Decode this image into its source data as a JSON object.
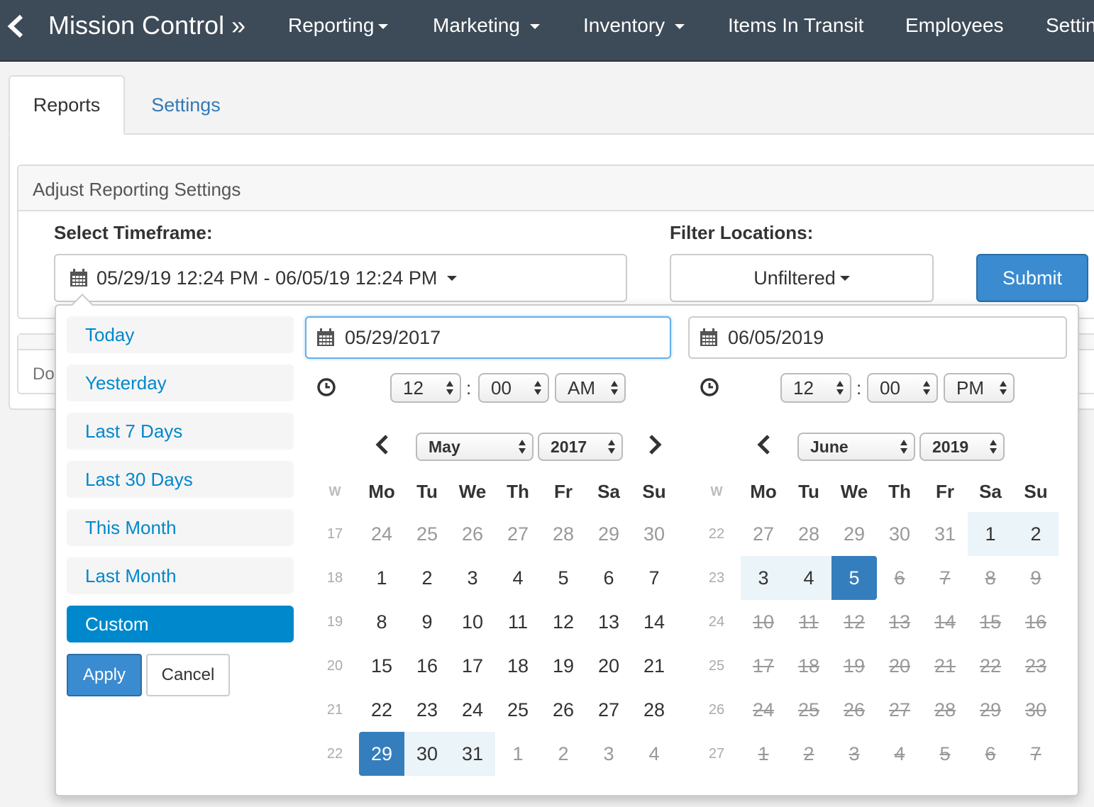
{
  "navbar": {
    "brand": "Mission Control »",
    "items": [
      "Reporting",
      "Marketing",
      "Inventory",
      "Items In Transit",
      "Employees",
      "Settings"
    ]
  },
  "tabs": {
    "active": "Reports",
    "other": "Settings"
  },
  "panel": {
    "title": "Adjust Reporting Settings",
    "timeframe_label": "Select Timeframe:",
    "timeframe_value": "05/29/19 12:24 PM - 06/05/19 12:24 PM",
    "filter_label": "Filter Locations:",
    "filter_value": "Unfiltered",
    "submit_label": "Submit",
    "second_panel_text": "Do"
  },
  "picker": {
    "ranges": [
      "Today",
      "Yesterday",
      "Last 7 Days",
      "Last 30 Days",
      "This Month",
      "Last Month",
      "Custom"
    ],
    "active_range": "Custom",
    "apply_label": "Apply",
    "cancel_label": "Cancel",
    "start": {
      "date": "05/29/2017",
      "hour": "12",
      "minute": "00",
      "ampm": "AM",
      "month": "May",
      "year": "2017",
      "weeks": [
        {
          "w": "17",
          "days": [
            [
              "24",
              "muted"
            ],
            [
              "25",
              "muted"
            ],
            [
              "26",
              "muted"
            ],
            [
              "27",
              "muted"
            ],
            [
              "28",
              "muted"
            ],
            [
              "29",
              "muted"
            ],
            [
              "30",
              "muted"
            ]
          ]
        },
        {
          "w": "18",
          "days": [
            [
              "1",
              ""
            ],
            [
              "2",
              ""
            ],
            [
              "3",
              ""
            ],
            [
              "4",
              ""
            ],
            [
              "5",
              ""
            ],
            [
              "6",
              ""
            ],
            [
              "7",
              ""
            ]
          ]
        },
        {
          "w": "19",
          "days": [
            [
              "8",
              ""
            ],
            [
              "9",
              ""
            ],
            [
              "10",
              ""
            ],
            [
              "11",
              ""
            ],
            [
              "12",
              ""
            ],
            [
              "13",
              ""
            ],
            [
              "14",
              ""
            ]
          ]
        },
        {
          "w": "20",
          "days": [
            [
              "15",
              ""
            ],
            [
              "16",
              ""
            ],
            [
              "17",
              ""
            ],
            [
              "18",
              ""
            ],
            [
              "19",
              ""
            ],
            [
              "20",
              ""
            ],
            [
              "21",
              ""
            ]
          ]
        },
        {
          "w": "21",
          "days": [
            [
              "22",
              ""
            ],
            [
              "23",
              ""
            ],
            [
              "24",
              ""
            ],
            [
              "25",
              ""
            ],
            [
              "26",
              ""
            ],
            [
              "27",
              ""
            ],
            [
              "28",
              ""
            ]
          ]
        },
        {
          "w": "22",
          "days": [
            [
              "29",
              "selected"
            ],
            [
              "30",
              "inrange"
            ],
            [
              "31",
              "inrange"
            ],
            [
              "1",
              "muted"
            ],
            [
              "2",
              "muted"
            ],
            [
              "3",
              "muted"
            ],
            [
              "4",
              "muted"
            ]
          ]
        }
      ]
    },
    "end": {
      "date": "06/05/2019",
      "hour": "12",
      "minute": "00",
      "ampm": "PM",
      "month": "June",
      "year": "2019",
      "weeks": [
        {
          "w": "22",
          "days": [
            [
              "27",
              "muted"
            ],
            [
              "28",
              "muted"
            ],
            [
              "29",
              "muted"
            ],
            [
              "30",
              "muted"
            ],
            [
              "31",
              "muted"
            ],
            [
              "1",
              "inrange"
            ],
            [
              "2",
              "inrange"
            ]
          ]
        },
        {
          "w": "23",
          "days": [
            [
              "3",
              "inrange"
            ],
            [
              "4",
              "inrange"
            ],
            [
              "5",
              "selected"
            ],
            [
              "6",
              "strike"
            ],
            [
              "7",
              "strike"
            ],
            [
              "8",
              "strike"
            ],
            [
              "9",
              "strike"
            ]
          ]
        },
        {
          "w": "24",
          "days": [
            [
              "10",
              "strike"
            ],
            [
              "11",
              "strike"
            ],
            [
              "12",
              "strike"
            ],
            [
              "13",
              "strike"
            ],
            [
              "14",
              "strike"
            ],
            [
              "15",
              "strike"
            ],
            [
              "16",
              "strike"
            ]
          ]
        },
        {
          "w": "25",
          "days": [
            [
              "17",
              "strike"
            ],
            [
              "18",
              "strike"
            ],
            [
              "19",
              "strike"
            ],
            [
              "20",
              "strike"
            ],
            [
              "21",
              "strike"
            ],
            [
              "22",
              "strike"
            ],
            [
              "23",
              "strike"
            ]
          ]
        },
        {
          "w": "26",
          "days": [
            [
              "24",
              "strike"
            ],
            [
              "25",
              "strike"
            ],
            [
              "26",
              "strike"
            ],
            [
              "27",
              "strike"
            ],
            [
              "28",
              "strike"
            ],
            [
              "29",
              "strike"
            ],
            [
              "30",
              "strike"
            ]
          ]
        },
        {
          "w": "27",
          "days": [
            [
              "1",
              "strike"
            ],
            [
              "2",
              "strike"
            ],
            [
              "3",
              "strike"
            ],
            [
              "4",
              "strike"
            ],
            [
              "5",
              "strike"
            ],
            [
              "6",
              "strike"
            ],
            [
              "7",
              "strike"
            ]
          ]
        }
      ]
    },
    "week_header": "W",
    "weekdays": [
      "Mo",
      "Tu",
      "We",
      "Th",
      "Fr",
      "Sa",
      "Su"
    ]
  },
  "colors": {
    "navbar_bg": "#3d4a57",
    "link": "#08c",
    "primary_button": "#3a8bd0",
    "selected_day": "#357ebd",
    "in_range_day": "#ebf4f8"
  },
  "icons": [
    "back-chevron-icon",
    "calendar-icon",
    "clock-icon",
    "caret-down-icon",
    "select-updown-icon",
    "prev-month-icon",
    "next-month-icon"
  ]
}
